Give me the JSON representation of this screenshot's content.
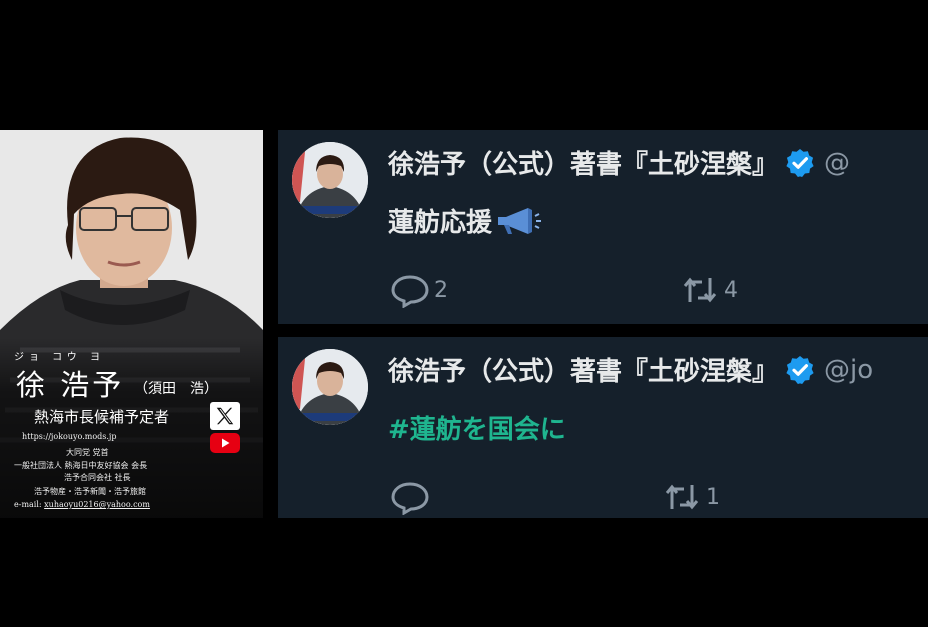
{
  "profile_card": {
    "furigana": "ジョ コウ ヨ",
    "name": "徐 浩予",
    "alias": "（須田　浩）",
    "role": "熱海市長候補予定者",
    "website": "https://jokouyo.mods.jp",
    "lines": [
      "大同党 党首",
      "一般社団法人 熱海日中友好協会 会長",
      "浩予合同会社 社長",
      "浩予物産・浩予新聞・浩予旅館"
    ],
    "email_label": "e-mail:",
    "email": "xuhaoyu0216@yahoo.com",
    "icons": [
      "x-logo-icon",
      "youtube-icon"
    ]
  },
  "tweets": [
    {
      "author": "徐浩予（公式）著書『土砂涅槃』",
      "handle": "@",
      "verified": true,
      "text": "蓮舫応援",
      "emoji": "megaphone-icon",
      "replies": "2",
      "retweets": "4"
    },
    {
      "author": "徐浩予（公式）著書『土砂涅槃』",
      "handle": "@jo",
      "verified": true,
      "text": "#蓮舫を国会に",
      "replies": "",
      "retweets": "1"
    }
  ],
  "colors": {
    "tweet_bg": "#15202b",
    "text": "#e7e9ea",
    "muted": "#8b98a5",
    "verified": "#1d9bf0",
    "hashtag": "#1fb58f",
    "page_bg": "#000000"
  }
}
